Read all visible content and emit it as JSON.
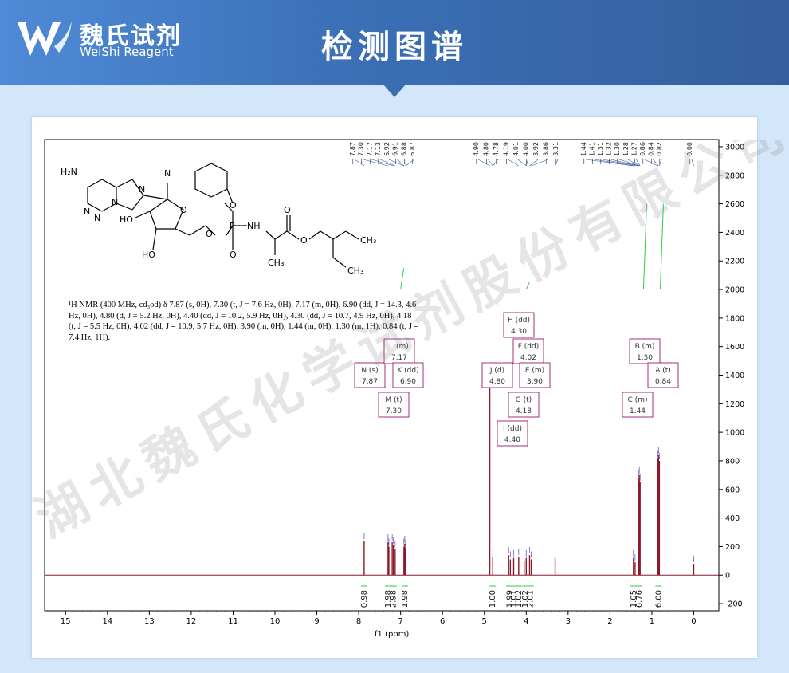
{
  "header": {
    "logo_cn": "魏氏试剂",
    "logo_en": "WeiShi Reagent",
    "title": "检测图谱"
  },
  "nmr_description": "¹H NMR (400 MHz, cd₃od) δ 7.87 (s, 0H), 7.30 (t, J = 7.6 Hz, 0H), 7.17 (m, 0H), 6.90 (dd, J = 14.3, 4.6 Hz, 0H), 4.80 (d, J = 5.2 Hz, 0H), 4.40 (dd, J = 10.2, 5.9 Hz, 0H), 4.30 (dd, J = 10.7, 4.9 Hz, 0H), 4.18 (t, J = 5.5 Hz, 0H), 4.02 (dd, J = 10.9, 5.7 Hz, 0H), 3.90 (m, 0H), 1.44 (m, 0H), 1.30 (m, 1H), 0.84 (t, J = 7.4 Hz, 1H).",
  "watermark": "湖北魏氏化学试剂股份有限公司",
  "structure_labels": [
    "H₂N",
    "N",
    "N",
    "N",
    "N",
    "N",
    "HO",
    "HO",
    "O",
    "O",
    "O",
    "O",
    "P",
    "NH",
    "O",
    "O",
    "CH₃",
    "CH₃",
    "CH₃"
  ],
  "chart_data": {
    "type": "line",
    "xlabel": "f1 (ppm)",
    "ylabel": "",
    "xlim": [
      15.5,
      -0.6
    ],
    "ylim": [
      -250,
      3050
    ],
    "x_ticks": [
      15,
      14,
      13,
      12,
      11,
      10,
      9,
      8,
      7,
      6,
      5,
      4,
      3,
      2,
      1,
      0
    ],
    "y_ticks": [
      3000,
      2800,
      2600,
      2400,
      2200,
      2000,
      1800,
      1600,
      1400,
      1200,
      1000,
      800,
      600,
      400,
      200,
      0,
      -200
    ],
    "peak_labels_top": [
      "7.87",
      "7.30",
      "7.17",
      "7.13",
      "6.92",
      "6.91",
      "6.88",
      "6.87",
      "4.90",
      "4.80",
      "4.78",
      "4.19",
      "4.01",
      "4.00",
      "3.92",
      "3.86",
      "3.31",
      "1.44",
      "1.41",
      "1.31",
      "1.32",
      "1.30",
      "1.28",
      "1.27",
      "0.86",
      "0.84",
      "0.82",
      "0.00"
    ],
    "peaks": [
      {
        "ppm": 7.87,
        "height": 240
      },
      {
        "ppm": 7.3,
        "height": 230
      },
      {
        "ppm": 7.28,
        "height": 200
      },
      {
        "ppm": 7.2,
        "height": 230
      },
      {
        "ppm": 7.17,
        "height": 210
      },
      {
        "ppm": 7.13,
        "height": 180
      },
      {
        "ppm": 6.92,
        "height": 200
      },
      {
        "ppm": 6.9,
        "height": 220
      },
      {
        "ppm": 6.88,
        "height": 190
      },
      {
        "ppm": 4.87,
        "height": 1380
      },
      {
        "ppm": 4.8,
        "height": 130
      },
      {
        "ppm": 4.42,
        "height": 140
      },
      {
        "ppm": 4.38,
        "height": 110
      },
      {
        "ppm": 4.3,
        "height": 120
      },
      {
        "ppm": 4.18,
        "height": 130
      },
      {
        "ppm": 4.05,
        "height": 100
      },
      {
        "ppm": 4.0,
        "height": 120
      },
      {
        "ppm": 3.92,
        "height": 140
      },
      {
        "ppm": 3.88,
        "height": 110
      },
      {
        "ppm": 3.31,
        "height": 120
      },
      {
        "ppm": 1.44,
        "height": 120
      },
      {
        "ppm": 1.4,
        "height": 90
      },
      {
        "ppm": 1.32,
        "height": 680
      },
      {
        "ppm": 1.3,
        "height": 700
      },
      {
        "ppm": 1.28,
        "height": 650
      },
      {
        "ppm": 0.86,
        "height": 820
      },
      {
        "ppm": 0.84,
        "height": 840
      },
      {
        "ppm": 0.82,
        "height": 800
      },
      {
        "ppm": 0.0,
        "height": 80
      }
    ],
    "multiplet_boxes": [
      {
        "letter": "N (s)",
        "value": "7.87",
        "ppm": 7.87
      },
      {
        "letter": "L (m)",
        "value": "7.17",
        "ppm": 7.17
      },
      {
        "letter": "K (dd)",
        "value": "6.90",
        "ppm": 6.9
      },
      {
        "letter": "M (t)",
        "value": "7.30",
        "ppm": 7.3
      },
      {
        "letter": "H (dd)",
        "value": "4.30",
        "ppm": 4.3
      },
      {
        "letter": "F (dd)",
        "value": "4.02",
        "ppm": 4.02
      },
      {
        "letter": "J (d)",
        "value": "4.80",
        "ppm": 4.8
      },
      {
        "letter": "E (m)",
        "value": "3.90",
        "ppm": 3.9
      },
      {
        "letter": "G (t)",
        "value": "4.18",
        "ppm": 4.18
      },
      {
        "letter": "I (dd)",
        "value": "4.40",
        "ppm": 4.4
      },
      {
        "letter": "B (m)",
        "value": "1.30",
        "ppm": 1.3
      },
      {
        "letter": "A (t)",
        "value": "0.84",
        "ppm": 0.84
      },
      {
        "letter": "C (m)",
        "value": "1.44",
        "ppm": 1.44
      }
    ],
    "integrals": [
      {
        "ppm": 7.87,
        "value": "0.98"
      },
      {
        "ppm": 7.3,
        "value": "1.98"
      },
      {
        "ppm": 7.17,
        "value": "2.98"
      },
      {
        "ppm": 6.9,
        "value": "1.98"
      },
      {
        "ppm": 4.8,
        "value": "1.00"
      },
      {
        "ppm": 4.4,
        "value": "1.99"
      },
      {
        "ppm": 4.3,
        "value": "1.01"
      },
      {
        "ppm": 4.18,
        "value": "1.02"
      },
      {
        "ppm": 4.02,
        "value": "1.02"
      },
      {
        "ppm": 3.9,
        "value": "2.01"
      },
      {
        "ppm": 1.44,
        "value": "1.05"
      },
      {
        "ppm": 1.3,
        "value": "6.76"
      },
      {
        "ppm": 0.84,
        "value": "6.00"
      }
    ]
  }
}
